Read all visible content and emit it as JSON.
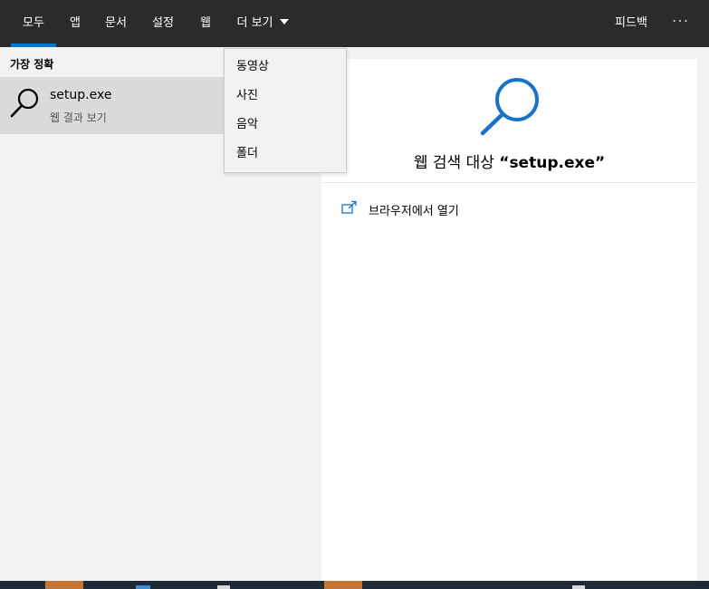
{
  "tabs": [
    {
      "label": "모두",
      "active": true
    },
    {
      "label": "앱"
    },
    {
      "label": "문서"
    },
    {
      "label": "설정"
    },
    {
      "label": "웹"
    },
    {
      "label": "더 보기"
    }
  ],
  "header": {
    "feedback_label": "피드백",
    "more_glyph": "···"
  },
  "left": {
    "section_title": "가장 정확",
    "best_match": {
      "title": "setup.exe",
      "subtitle": "웹 결과 보기",
      "icon": "search-icon"
    }
  },
  "dropdown": {
    "items": [
      "동영상",
      "사진",
      "음악",
      "폴더"
    ]
  },
  "right": {
    "heading_prefix": "웹 검색 대상 ",
    "query": "“setup.exe”",
    "open_browser_label": "브라우저에서 열기",
    "open_browser_icon": "open-in-new-window-icon"
  },
  "colors": {
    "topbar": "#2b2b2b",
    "accent": "#0078d7",
    "selected_row": "#dadada",
    "pane": "#f2f2f2",
    "taskbar_highlight": "#c87533"
  }
}
